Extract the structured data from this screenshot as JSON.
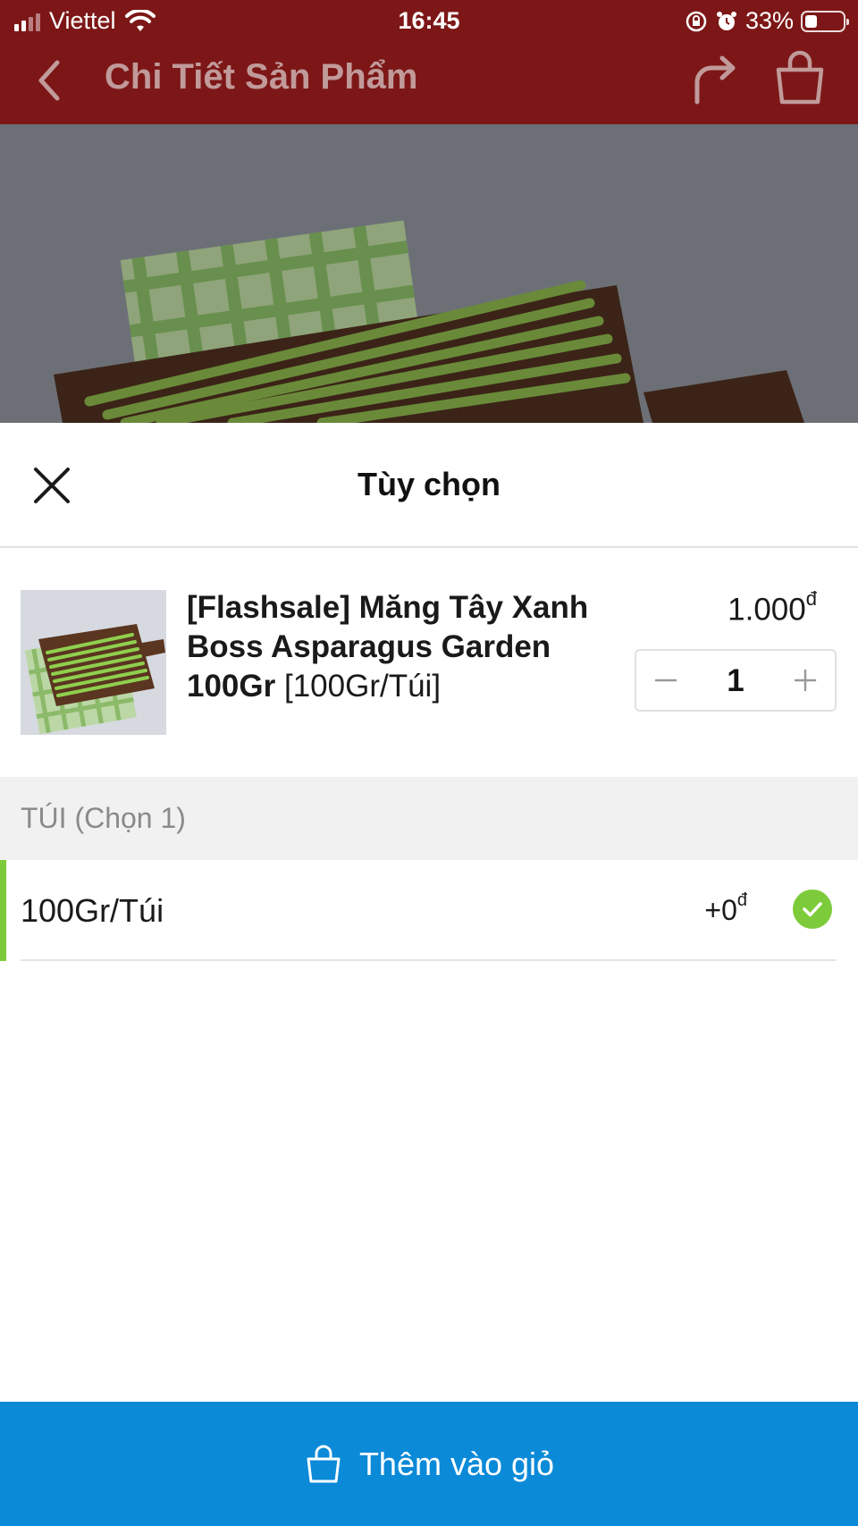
{
  "status_bar": {
    "carrier": "Viettel",
    "time": "16:45",
    "battery": "33%",
    "battery_level": 0.33,
    "icons": [
      "signal-icon",
      "wifi-icon",
      "orientation-lock-icon",
      "alarm-icon",
      "battery-icon"
    ]
  },
  "nav": {
    "title": "Chi Tiết Sản Phẩm",
    "icons": [
      "back-arrow-icon",
      "share-icon",
      "shopping-bag-icon"
    ]
  },
  "sheet": {
    "title": "Tùy chọn",
    "close_icon": "close-icon"
  },
  "product": {
    "name": "[Flashsale] Măng Tây Xanh Boss Asparagus Garden 100Gr",
    "variant": "[100Gr/Túi]",
    "price": "1.000",
    "currency": "đ",
    "quantity": "1",
    "image_alt": "asparagus on cutting board"
  },
  "option_group": {
    "title": "TÚI (Chọn 1)",
    "options": [
      {
        "label": "100Gr/Túi",
        "price": "+0",
        "currency": "đ",
        "selected": true
      }
    ]
  },
  "cta": {
    "label": "Thêm vào giỏ",
    "icon": "shopping-bag-icon"
  },
  "colors": {
    "header": "#7d1717",
    "accent_green": "#7dcb3a",
    "check_green": "#7dcb3a",
    "cta_blue": "#0b8ad8"
  }
}
